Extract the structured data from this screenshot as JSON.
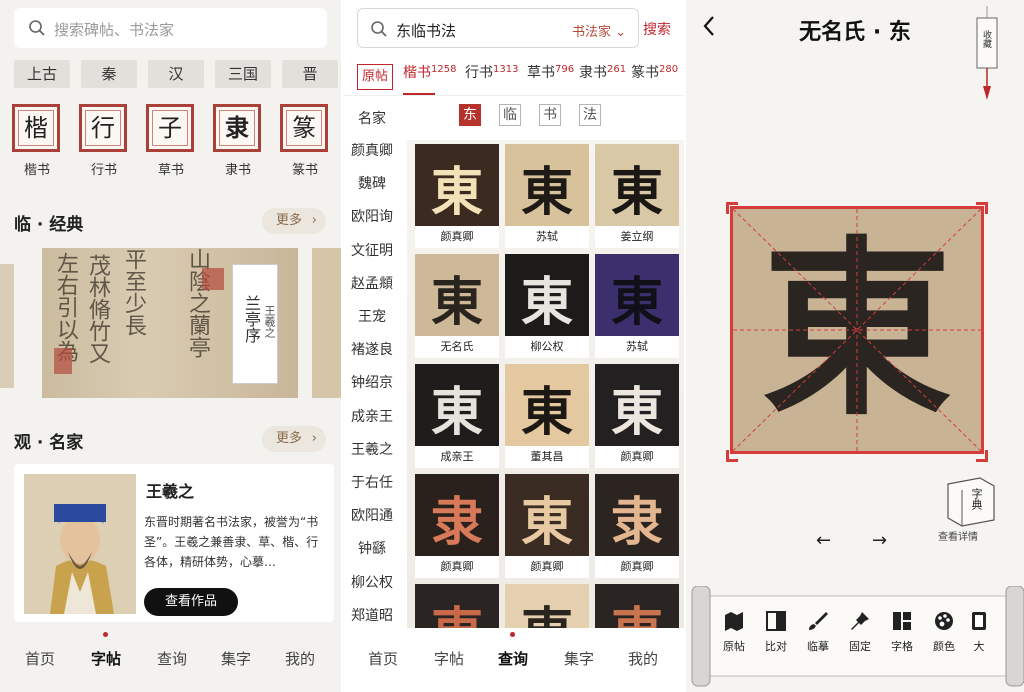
{
  "screen1": {
    "search_placeholder": "搜索碑帖、书法家",
    "dynasties": [
      "上古",
      "秦",
      "汉",
      "三国",
      "晋"
    ],
    "styles": [
      {
        "glyph": "楷",
        "label": "楷书"
      },
      {
        "glyph": "行",
        "label": "行书"
      },
      {
        "glyph": "子",
        "label": "草书"
      },
      {
        "glyph": "隶",
        "label": "隶书"
      },
      {
        "glyph": "篆",
        "label": "篆书"
      }
    ],
    "classics_title": "临 · 经典",
    "more_label": "更多",
    "banner": {
      "work_title": "兰亭序",
      "author": "王羲之"
    },
    "artists_title": "观 · 名家",
    "artist": {
      "name": "王羲之",
      "description": "东晋时期著名书法家，被誉为“书圣”。王羲之兼善隶、草、楷、行各体，精研体势，心摹…",
      "button": "查看作品"
    },
    "tabs": [
      "首页",
      "字帖",
      "查询",
      "集字",
      "我的"
    ],
    "active_tab": 1
  },
  "screen2": {
    "search_value": "东临书法",
    "filter_label": "书法家",
    "search_button": "搜索",
    "original_label": "原帖",
    "categories": [
      {
        "name": "楷书",
        "count": "1258"
      },
      {
        "name": "行书",
        "count": "1313"
      },
      {
        "name": "草书",
        "count": "796"
      },
      {
        "name": "隶书",
        "count": "261"
      },
      {
        "name": "篆书",
        "count": "280"
      }
    ],
    "names_header": "名家",
    "names": [
      "颜真卿",
      "魏碑",
      "欧阳询",
      "文征明",
      "赵孟頫",
      "王宠",
      "褚遂良",
      "钟绍京",
      "成亲王",
      "王羲之",
      "于右任",
      "欧阳通",
      "钟繇",
      "柳公权",
      "郑道昭"
    ],
    "query_chars": [
      "东",
      "临",
      "书",
      "法"
    ],
    "results": [
      {
        "glyph": "東",
        "caption": "颜真卿",
        "bg": "#3a2a20",
        "fg": "#f3e2b8"
      },
      {
        "glyph": "東",
        "caption": "苏轼",
        "bg": "#d8c29c",
        "fg": "#1e1a16"
      },
      {
        "glyph": "東",
        "caption": "姜立纲",
        "bg": "#d9c8a6",
        "fg": "#1a1714"
      },
      {
        "glyph": "東",
        "caption": "无名氏",
        "bg": "#cdb898",
        "fg": "#2a241e"
      },
      {
        "glyph": "東",
        "caption": "柳公权",
        "bg": "#1d1b1a",
        "fg": "#e8e4de"
      },
      {
        "glyph": "東",
        "caption": "苏轼",
        "bg": "#3b2f6e",
        "fg": "#111018"
      },
      {
        "glyph": "東",
        "caption": "成亲王",
        "bg": "#1f1d1c",
        "fg": "#e6e2dc"
      },
      {
        "glyph": "東",
        "caption": "董其昌",
        "bg": "#e4c8a0",
        "fg": "#1c1814"
      },
      {
        "glyph": "東",
        "caption": "颜真卿",
        "bg": "#222020",
        "fg": "#ece6de"
      },
      {
        "glyph": "隶",
        "caption": "颜真卿",
        "bg": "#2a201c",
        "fg": "#d87a5a"
      },
      {
        "glyph": "東",
        "caption": "颜真卿",
        "bg": "#3a2c22",
        "fg": "#e7c9a2"
      },
      {
        "glyph": "隶",
        "caption": "颜真卿",
        "bg": "#2c2420",
        "fg": "#e3b690"
      },
      {
        "glyph": "東",
        "caption": "",
        "bg": "#2a2422",
        "fg": "#c86a4a"
      },
      {
        "glyph": "東",
        "caption": "",
        "bg": "#e4cfae",
        "fg": "#2a241e"
      },
      {
        "glyph": "東",
        "caption": "",
        "bg": "#2a2422",
        "fg": "#c8744e"
      }
    ],
    "tabs": [
      "首页",
      "字帖",
      "查询",
      "集字",
      "我的"
    ],
    "active_tab": 2
  },
  "screen3": {
    "title": "无名氏 · 东",
    "bookmark_label": "收藏",
    "big_glyph": "東",
    "dict_glyph": "字典",
    "dict_label": "查看详情",
    "prev_label": "←",
    "next_label": "→",
    "tools": [
      "原帖",
      "比对",
      "临摹",
      "固定",
      "字格",
      "颜色",
      "大"
    ]
  },
  "colors": {
    "accent_red": "#c0272d",
    "seal_red": "#a9403a",
    "paper": "#f4f2ef"
  }
}
